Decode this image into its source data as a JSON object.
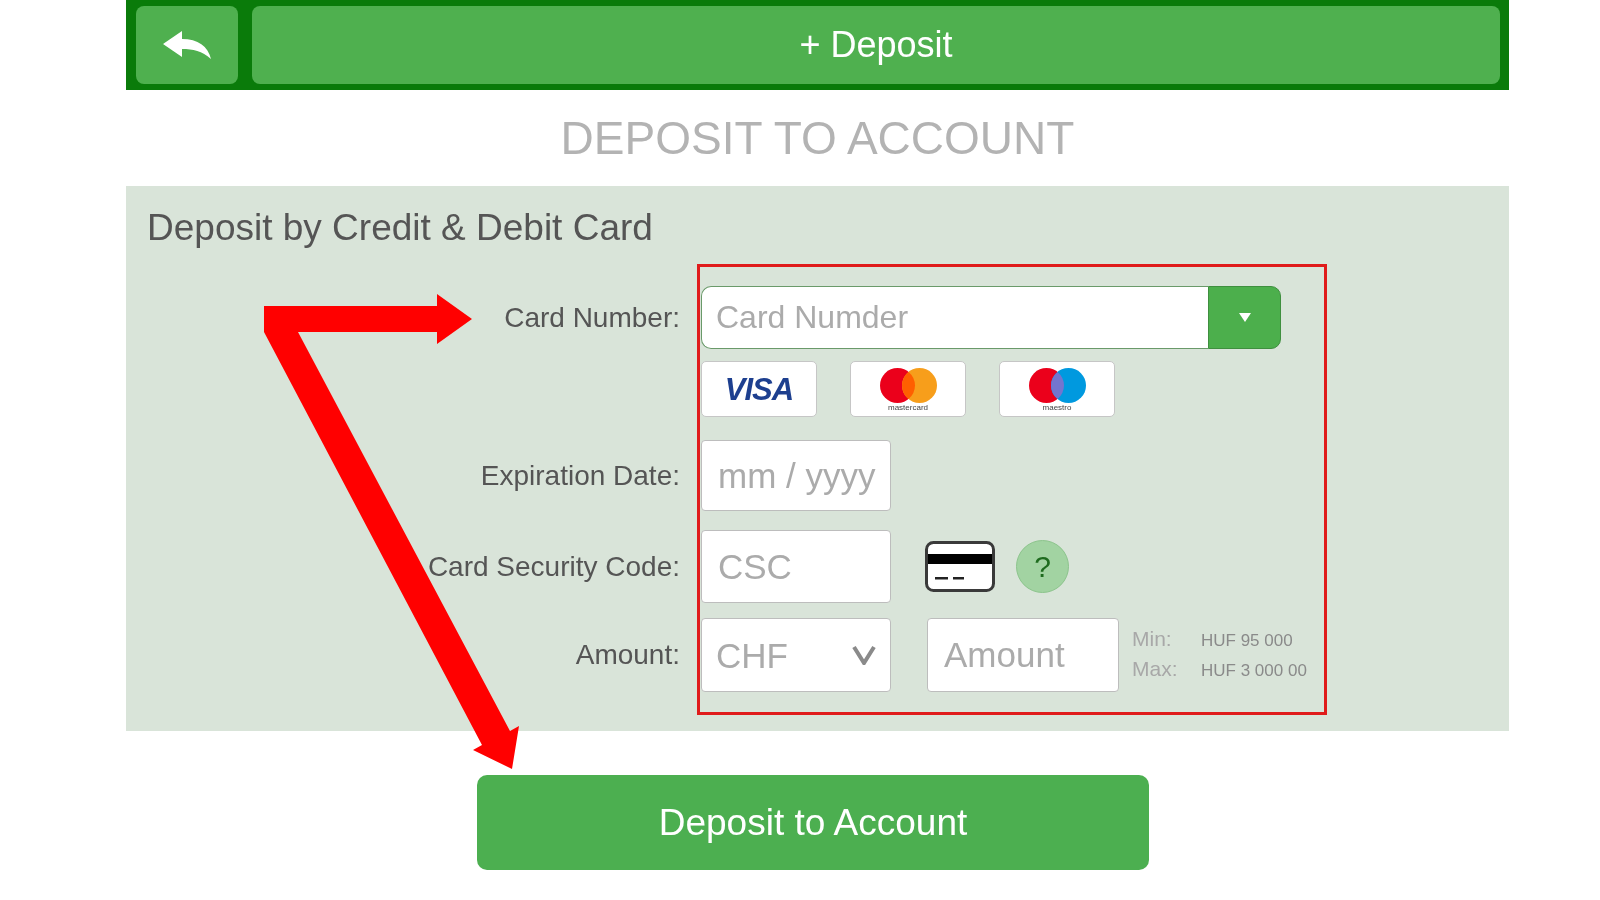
{
  "top_bar": {
    "title": "+ Deposit"
  },
  "heading": "DEPOSIT TO ACCOUNT",
  "card_panel": {
    "title": "Deposit by Credit & Debit Card",
    "rows": [
      {
        "kind": "card_number",
        "label": "Card Number:",
        "placeholder": "Card Numder"
      },
      {
        "kind": "card_logos",
        "logos": [
          {
            "kind": "visa",
            "text": "VISA"
          },
          {
            "kind": "mastercard",
            "text": "mastercard"
          },
          {
            "kind": "maestro",
            "text": "maestro"
          }
        ]
      },
      {
        "kind": "text",
        "label": "Expiration Date:",
        "placeholder": "mm / yyyy"
      },
      {
        "kind": "security_code",
        "label": "Card Security Code:",
        "placeholder": "CSC",
        "help": "?"
      },
      {
        "kind": "amount",
        "label": "Amount:",
        "currency": "CHF",
        "placeholder": "Amount",
        "limits": [
          {
            "label": "Min:",
            "value": "HUF 95 000"
          },
          {
            "label": "Max:",
            "value": "HUF 3 000 00"
          }
        ]
      }
    ]
  },
  "submit_button": "Deposit to Account"
}
